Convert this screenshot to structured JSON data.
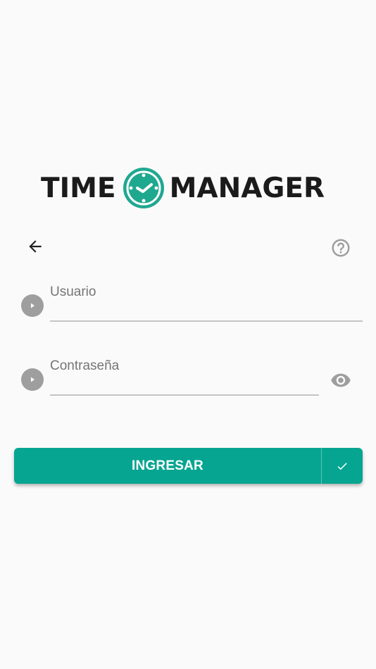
{
  "logo": {
    "word_left": "TIME",
    "word_right": "MANAGER",
    "icon": "clock-icon",
    "accent_color": "#1fa890",
    "text_color": "#1b1b1b"
  },
  "nav": {
    "back_icon": "arrow-back-icon",
    "help_icon": "help-circle-icon"
  },
  "form": {
    "username": {
      "label": "Usuario",
      "value": "",
      "bullet_icon": "play-circle-icon"
    },
    "password": {
      "label": "Contraseña",
      "value": "",
      "bullet_icon": "play-circle-icon",
      "toggle_icon": "eye-icon"
    }
  },
  "submit": {
    "label": "INGRESAR",
    "icon": "check-icon",
    "color": "#06a591"
  }
}
